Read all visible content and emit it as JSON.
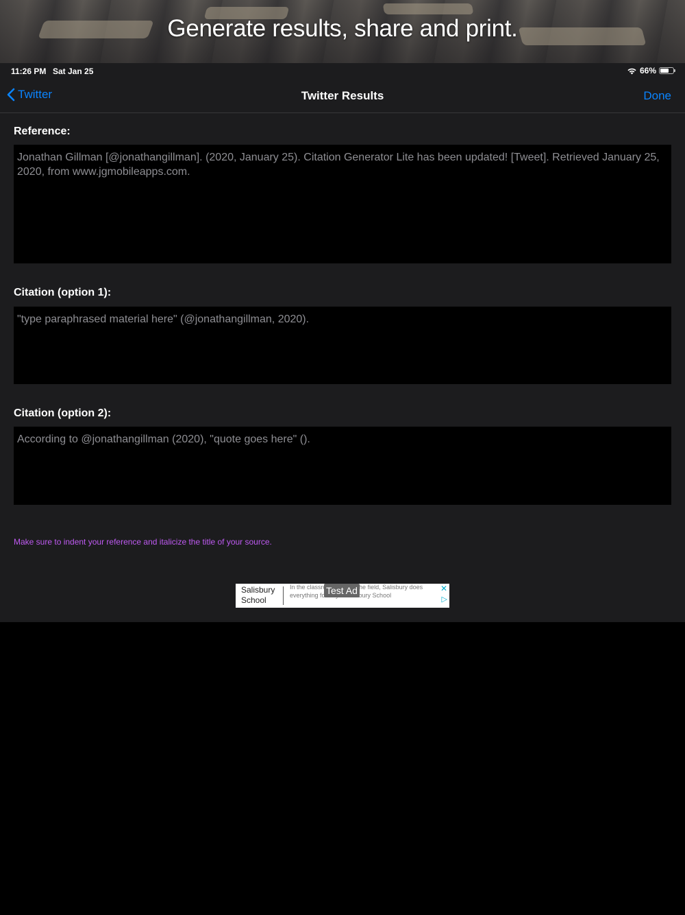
{
  "promo": {
    "headline": "Generate results, share and print."
  },
  "status": {
    "time": "11:26 PM",
    "date": "Sat Jan 25",
    "battery": "66%"
  },
  "nav": {
    "back_label": "Twitter",
    "title": "Twitter Results",
    "done_label": "Done"
  },
  "reference": {
    "label": "Reference:",
    "text": "Jonathan Gillman [@jonathangillman]. (2020, January 25). Citation Generator Lite has been updated! [Tweet]. Retrieved January 25, 2020, from www.jgmobileapps.com."
  },
  "citation1": {
    "label": "Citation (option 1):",
    "text": "\"type paraphrased material here\" (@jonathangillman, 2020)."
  },
  "citation2": {
    "label": "Citation (option 2):",
    "text": "According to @jonathangillman (2020), \"quote goes here\" ()."
  },
  "hint": "Make sure to indent your reference and italicize the title of your source.",
  "ad": {
    "brand": "Salisbury School",
    "copy": "In the classroom and on the field, Salisbury does everything for boys. Salisbury School",
    "badge": "Test Ad",
    "close": "✕",
    "adchoices": "▷"
  },
  "colors": {
    "accent": "#0a84ff",
    "hint": "#bf5af2",
    "background": "#1c1c1e"
  }
}
